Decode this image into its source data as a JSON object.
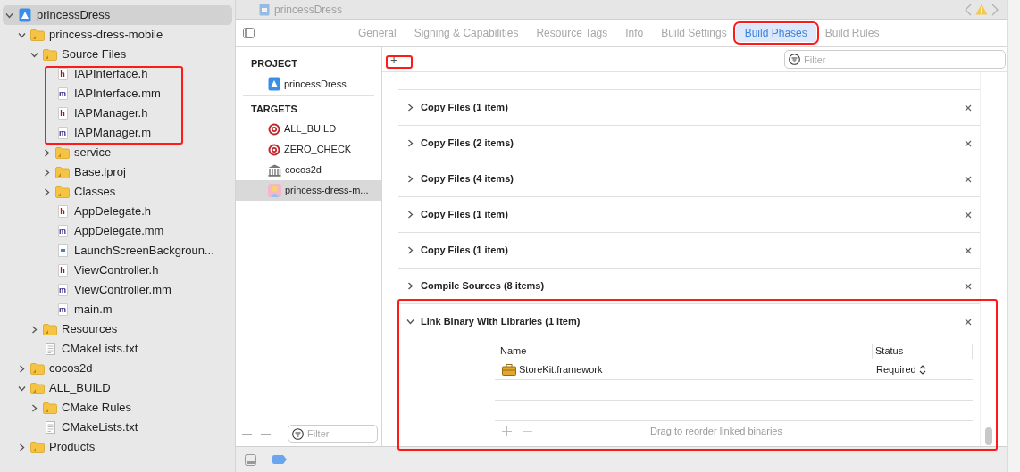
{
  "navigator": {
    "tree": [
      {
        "name": "princessDress",
        "kind": "project",
        "expanded": true,
        "selected": true,
        "children": [
          {
            "name": "princess-dress-mobile",
            "kind": "folder",
            "expanded": true,
            "selected": false,
            "children": [
              {
                "name": "Source Files",
                "kind": "folder",
                "expanded": true,
                "selected": false,
                "children": [
                  {
                    "name": "IAPInterface.h",
                    "kind": "file",
                    "letter": "h",
                    "selected": false
                  },
                  {
                    "name": "IAPInterface.mm",
                    "kind": "file",
                    "letter": "m",
                    "selected": false
                  },
                  {
                    "name": "IAPManager.h",
                    "kind": "file",
                    "letter": "h",
                    "selected": false
                  },
                  {
                    "name": "IAPManager.m",
                    "kind": "file",
                    "letter": "m",
                    "selected": false
                  },
                  {
                    "name": "service",
                    "kind": "folder",
                    "expanded": false,
                    "selected": false
                  },
                  {
                    "name": "Base.lproj",
                    "kind": "folder",
                    "expanded": false,
                    "selected": false
                  },
                  {
                    "name": "Classes",
                    "kind": "folder",
                    "expanded": false,
                    "selected": false
                  },
                  {
                    "name": "AppDelegate.h",
                    "kind": "file",
                    "letter": "h",
                    "selected": false
                  },
                  {
                    "name": "AppDelegate.mm",
                    "kind": "file",
                    "letter": "m",
                    "selected": false
                  },
                  {
                    "name": "LaunchScreenBackgroun...",
                    "kind": "storyboard",
                    "selected": false
                  },
                  {
                    "name": "ViewController.h",
                    "kind": "file",
                    "letter": "h",
                    "selected": false
                  },
                  {
                    "name": "ViewController.mm",
                    "kind": "file",
                    "letter": "m",
                    "selected": false
                  },
                  {
                    "name": "main.m",
                    "kind": "file",
                    "letter": "m",
                    "selected": false
                  }
                ]
              },
              {
                "name": "Resources",
                "kind": "folder",
                "expanded": false,
                "selected": false
              },
              {
                "name": "CMakeLists.txt",
                "kind": "text",
                "selected": false
              }
            ]
          },
          {
            "name": "cocos2d",
            "kind": "folder",
            "expanded": false,
            "selected": false
          },
          {
            "name": "ALL_BUILD",
            "kind": "folder",
            "expanded": true,
            "selected": false,
            "children": [
              {
                "name": "CMake Rules",
                "kind": "folder",
                "expanded": false,
                "selected": false
              },
              {
                "name": "CMakeLists.txt",
                "kind": "text",
                "selected": false
              }
            ]
          },
          {
            "name": "Products",
            "kind": "folder",
            "expanded": false,
            "selected": false
          }
        ]
      }
    ]
  },
  "editor": {
    "title": "princessDress",
    "tabs": [
      {
        "label": "General",
        "selected": false
      },
      {
        "label": "Signing & Capabilities",
        "selected": false
      },
      {
        "label": "Resource Tags",
        "selected": false
      },
      {
        "label": "Info",
        "selected": false
      },
      {
        "label": "Build Settings",
        "selected": false
      },
      {
        "label": "Build Phases",
        "selected": true
      },
      {
        "label": "Build Rules",
        "selected": false
      }
    ],
    "targets_panel": {
      "project_header": "PROJECT",
      "project": {
        "name": "princessDress",
        "kind": "project",
        "selected": false
      },
      "targets_header": "TARGETS",
      "targets": [
        {
          "name": "ALL_BUILD",
          "kind": "target",
          "selected": false
        },
        {
          "name": "ZERO_CHECK",
          "kind": "target",
          "selected": false
        },
        {
          "name": "cocos2d",
          "kind": "library",
          "selected": false
        },
        {
          "name": "princess-dress-m...",
          "kind": "app",
          "selected": true
        }
      ],
      "filter": {
        "placeholder": "Filter"
      }
    },
    "phases": {
      "add_button": "+",
      "filter": {
        "placeholder": "Filter"
      },
      "items": [
        {
          "title": "Copy Files (1 item)",
          "expanded": false
        },
        {
          "title": "Copy Files (2 items)",
          "expanded": false
        },
        {
          "title": "Copy Files (4 items)",
          "expanded": false
        },
        {
          "title": "Copy Files (1 item)",
          "expanded": false
        },
        {
          "title": "Copy Files (1 item)",
          "expanded": false
        },
        {
          "title": "Compile Sources (8 items)",
          "expanded": false
        },
        {
          "title": "Link Binary With Libraries (1 item)",
          "expanded": true,
          "table": {
            "columns": [
              "Name",
              "Status"
            ],
            "rows": [
              {
                "name": "StoreKit.framework",
                "status": "Required"
              }
            ],
            "hint": "Drag to reorder linked binaries"
          }
        }
      ]
    }
  }
}
